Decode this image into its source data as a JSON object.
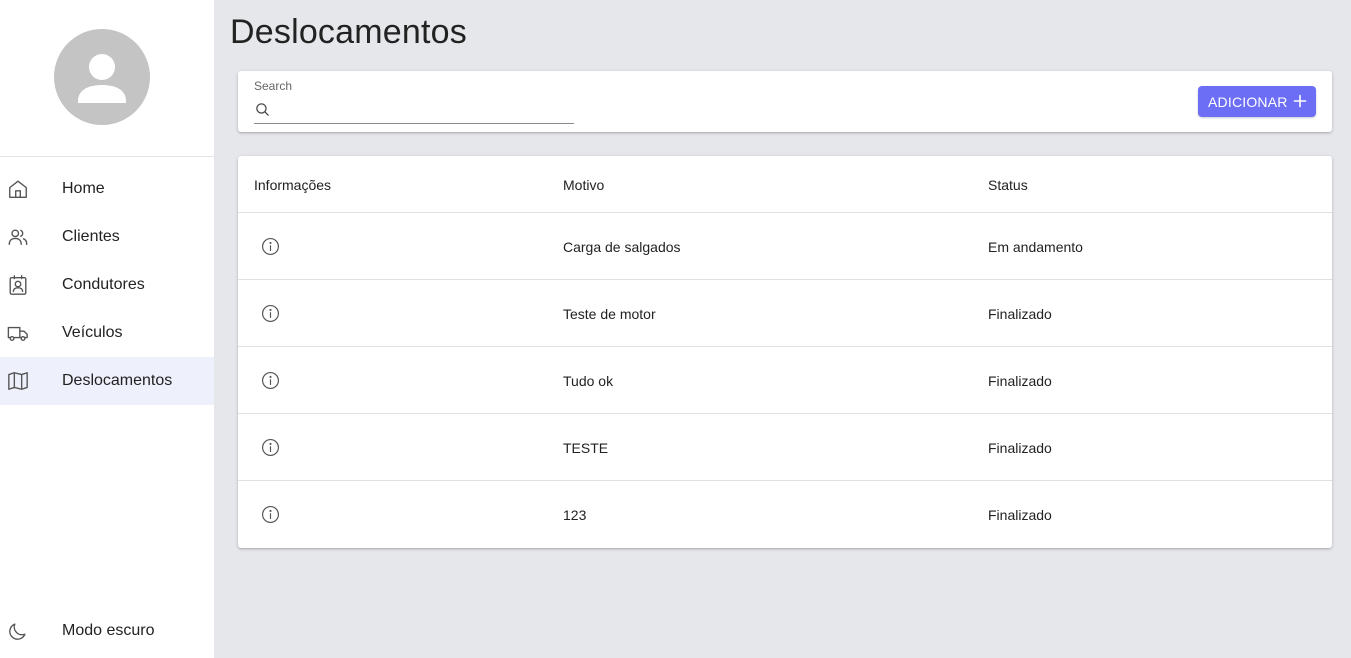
{
  "sidebar": {
    "items": [
      {
        "label": "Home",
        "icon": "home-icon",
        "active": false
      },
      {
        "label": "Clientes",
        "icon": "users-icon",
        "active": false
      },
      {
        "label": "Condutores",
        "icon": "id-badge-icon",
        "active": false
      },
      {
        "label": "Veículos",
        "icon": "truck-icon",
        "active": false
      },
      {
        "label": "Deslocamentos",
        "icon": "map-icon",
        "active": true
      }
    ],
    "dark_mode_label": "Modo escuro"
  },
  "page": {
    "title": "Deslocamentos"
  },
  "search": {
    "label": "Search",
    "value": "",
    "placeholder": ""
  },
  "toolbar": {
    "add_label": "ADICIONAR"
  },
  "table": {
    "headers": [
      "Informações",
      "Motivo",
      "Status"
    ],
    "rows": [
      {
        "motivo": "Carga de salgados",
        "status": "Em andamento"
      },
      {
        "motivo": "Teste de motor",
        "status": "Finalizado"
      },
      {
        "motivo": "Tudo ok",
        "status": "Finalizado"
      },
      {
        "motivo": "TESTE",
        "status": "Finalizado"
      },
      {
        "motivo": "123",
        "status": "Finalizado"
      }
    ]
  },
  "colors": {
    "accent": "#6c6ef5",
    "active_nav_bg": "#eef0fb",
    "page_bg": "#e6e7eb"
  }
}
